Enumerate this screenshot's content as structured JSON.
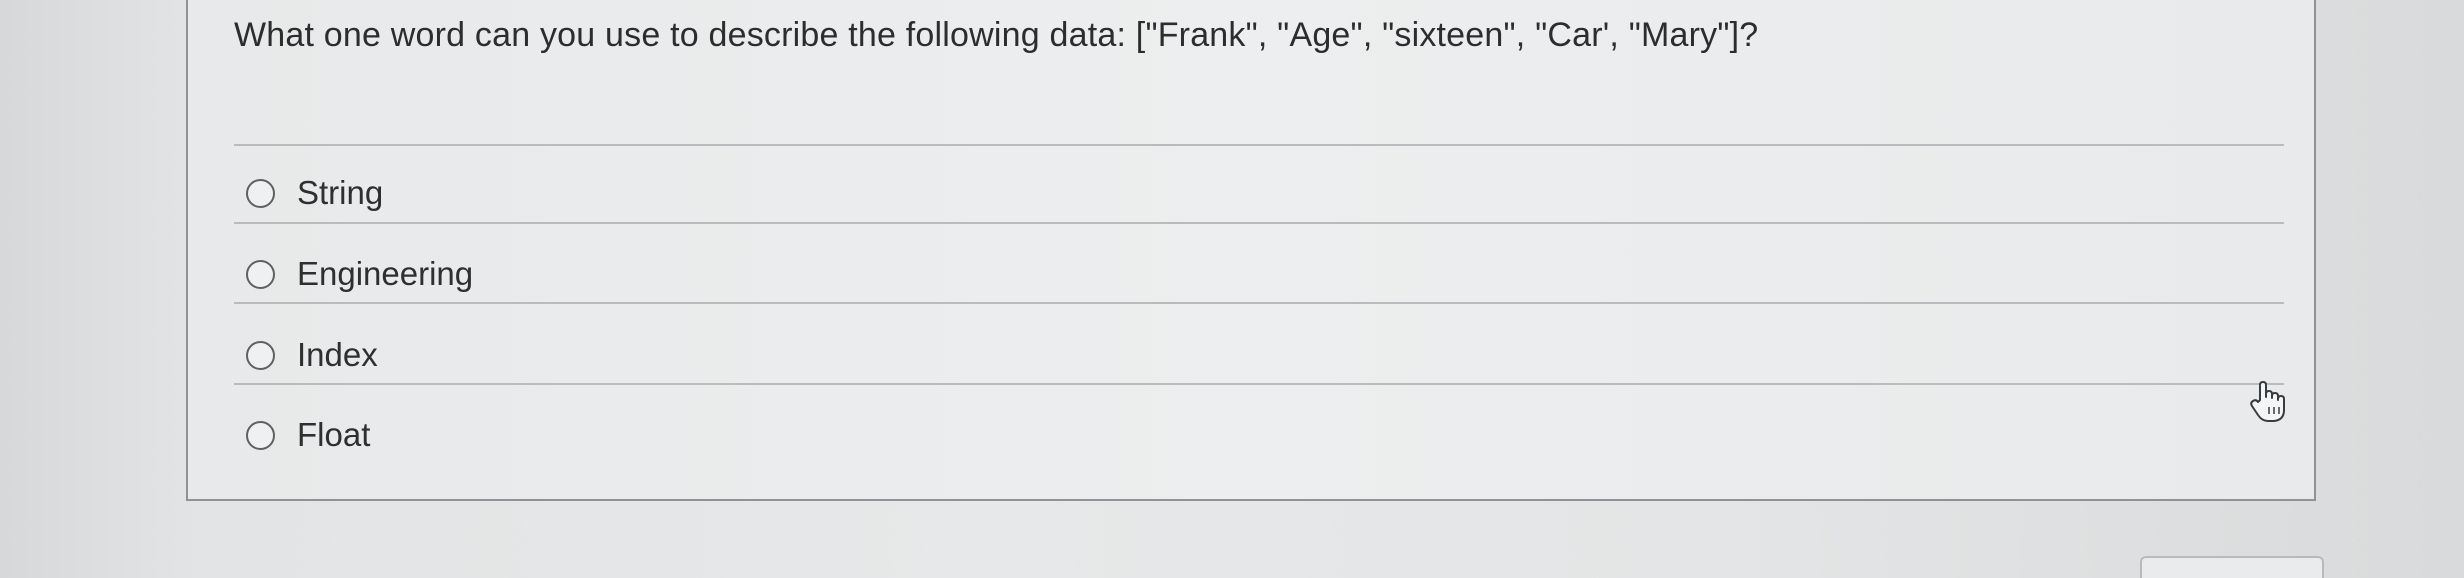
{
  "question": {
    "text": "What one word can you use to describe the following data: [\"Frank\", \"Age\", \"sixteen\", \"Car', \"Mary\"]?"
  },
  "options": [
    {
      "label": "String"
    },
    {
      "label": "Engineering"
    },
    {
      "label": "Index"
    },
    {
      "label": "Float"
    }
  ],
  "icons": {
    "cursor": "hand-pointer-icon",
    "radio": "radio-circle-icon"
  },
  "colors": {
    "text": "#2b2d2f",
    "divider": "#b9bcbe",
    "card_border": "#8f9396"
  }
}
